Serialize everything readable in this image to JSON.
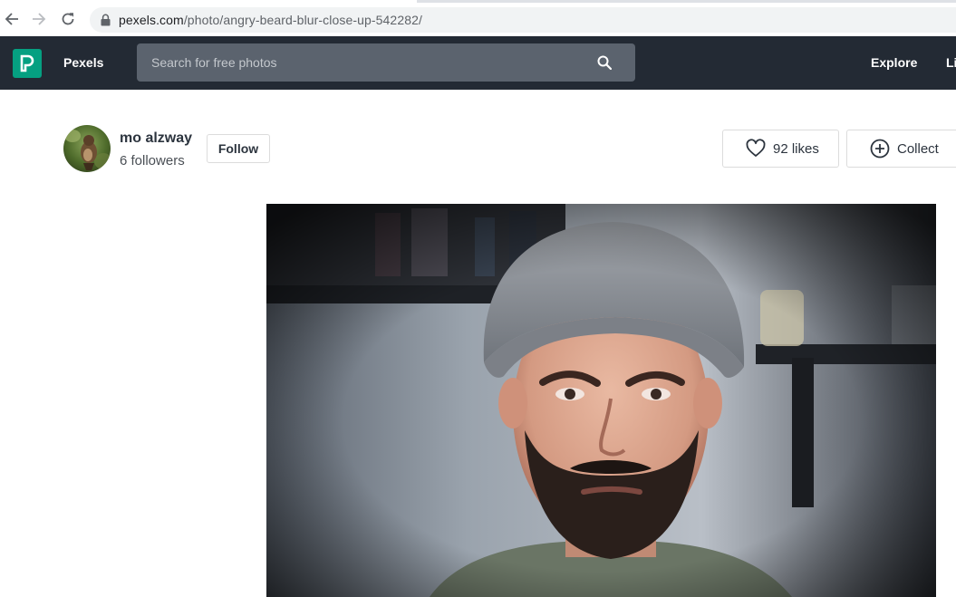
{
  "browser": {
    "url_domain": "pexels.com",
    "url_path": "/photo/angry-beard-blur-close-up-542282/"
  },
  "header": {
    "brand": "Pexels",
    "search_placeholder": "Search for free photos",
    "nav": [
      "Explore",
      "Li"
    ]
  },
  "photographer": {
    "name": "mo alzway",
    "followers": "6 followers",
    "follow_label": "Follow"
  },
  "actions": {
    "likes_label": "92 likes",
    "collect_label": "Collect"
  },
  "colors": {
    "header_bg": "#232a34",
    "logo_accent": "#05a081",
    "search_bg": "#5b636e"
  },
  "icons": [
    "back-arrow-icon",
    "forward-arrow-icon",
    "reload-icon",
    "lock-icon",
    "pexels-logo-icon",
    "search-icon",
    "heart-icon",
    "plus-circle-icon"
  ]
}
